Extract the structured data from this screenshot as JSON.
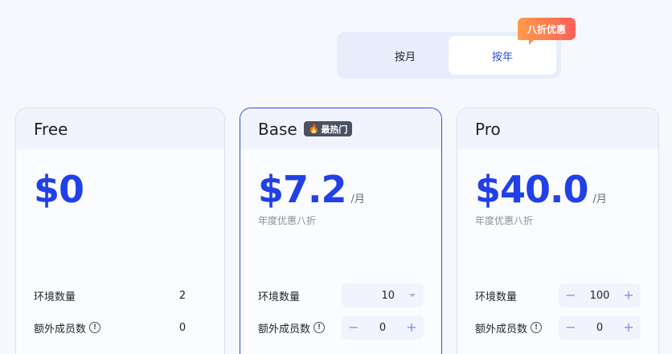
{
  "billing_toggle": {
    "monthly_label": "按月",
    "yearly_label": "按年",
    "selected": "yearly",
    "discount_badge": "八折优惠"
  },
  "plans": [
    {
      "name": "Free",
      "price": "$0",
      "period": "",
      "note": "",
      "features": [
        {
          "label": "环境数量",
          "value": "2",
          "control": "static"
        },
        {
          "label": "额外成员数",
          "value": "0",
          "control": "static",
          "info": true
        }
      ]
    },
    {
      "name": "Base",
      "badge": "最热门",
      "price": "$7.2",
      "period": "/月",
      "note": "年度优惠八折",
      "features": [
        {
          "label": "环境数量",
          "value": "10",
          "control": "select"
        },
        {
          "label": "额外成员数",
          "value": "0",
          "control": "stepper",
          "info": true
        }
      ]
    },
    {
      "name": "Pro",
      "price": "$40.0",
      "period": "/月",
      "note": "年度优惠八折",
      "features": [
        {
          "label": "环境数量",
          "value": "100",
          "control": "stepper"
        },
        {
          "label": "额外成员数",
          "value": "0",
          "control": "stepper",
          "info": true
        }
      ]
    }
  ],
  "colors": {
    "accent": "#2140e8",
    "toggle_bg": "#e8edfb",
    "badge_gradient_start": "#ff9c4a",
    "badge_gradient_end": "#ff5f57"
  },
  "icons": {
    "info": "info-circle-icon",
    "flame": "flame-icon",
    "caret": "chevron-down-icon",
    "minus": "minus-icon",
    "plus": "plus-icon"
  },
  "glyphs": {
    "info": "!",
    "flame": "🔥",
    "minus": "−",
    "plus": "+"
  }
}
